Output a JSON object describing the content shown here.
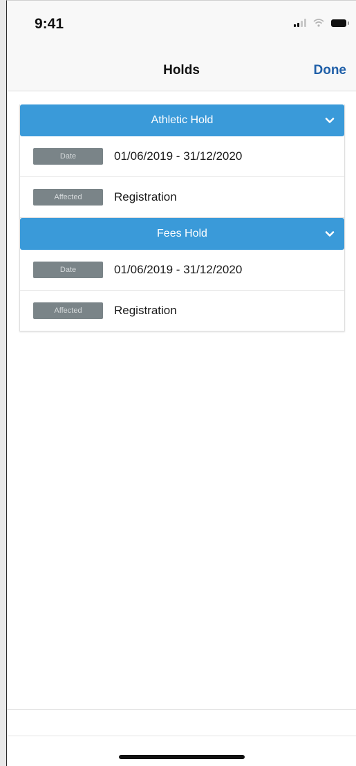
{
  "status_bar": {
    "time": "9:41",
    "icons": [
      "signal-icon",
      "wifi-icon",
      "battery-icon"
    ]
  },
  "nav": {
    "title": "Holds",
    "done_label": "Done"
  },
  "holds": [
    {
      "title": "Athletic Hold",
      "rows": [
        {
          "label": "Date",
          "value": "01/06/2019 - 31/12/2020"
        },
        {
          "label": "Affected",
          "value": "Registration"
        }
      ]
    },
    {
      "title": "Fees Hold",
      "rows": [
        {
          "label": "Date",
          "value": "01/06/2019 - 31/12/2020"
        },
        {
          "label": "Affected",
          "value": "Registration"
        }
      ]
    }
  ],
  "colors": {
    "header_blue": "#3a9ad9",
    "badge_gray": "#7a8488",
    "done_blue": "#1f5fa8"
  }
}
